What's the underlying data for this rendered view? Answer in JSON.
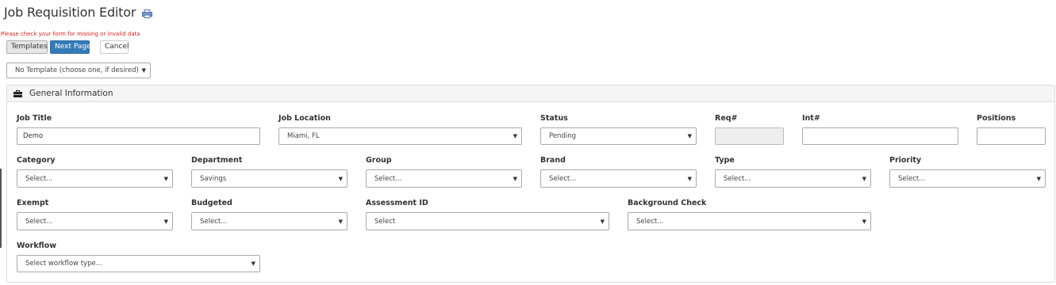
{
  "header": {
    "title": "Job Requisition Editor",
    "icon": "print-icon"
  },
  "error_message": "Please check your form for missing or invalid data",
  "toolbar": {
    "templates_label": "Templates",
    "next_page_label": "Next Page",
    "cancel_label": "Cancel"
  },
  "template_select": {
    "value": "No Template (choose one, if desired)"
  },
  "panel": {
    "title": "General Information",
    "icon": "briefcase-icon"
  },
  "fields": {
    "job_title": {
      "label": "Job Title",
      "value": "Demo"
    },
    "job_location": {
      "label": "Job Location",
      "value": "Miami, FL"
    },
    "status": {
      "label": "Status",
      "value": "Pending"
    },
    "req_number": {
      "label": "Req#",
      "value": ""
    },
    "int_number": {
      "label": "Int#",
      "value": ""
    },
    "positions": {
      "label": "Positions",
      "value": ""
    },
    "category": {
      "label": "Category",
      "value": "Select..."
    },
    "department": {
      "label": "Department",
      "value": "Savings"
    },
    "group": {
      "label": "Group",
      "value": "Select..."
    },
    "brand": {
      "label": "Brand",
      "value": "Select..."
    },
    "type": {
      "label": "Type",
      "value": "Select..."
    },
    "priority": {
      "label": "Priority",
      "value": "Select..."
    },
    "exempt": {
      "label": "Exempt",
      "value": "Select..."
    },
    "budgeted": {
      "label": "Budgeted",
      "value": "Select..."
    },
    "assessment_id": {
      "label": "Assessment ID",
      "value": "Select"
    },
    "background_check": {
      "label": "Background Check",
      "value": "Select..."
    },
    "workflow": {
      "label": "Workflow",
      "value": "Select workflow type..."
    }
  },
  "caret_glyph": "▼",
  "colors": {
    "primary": "#337ab7",
    "error": "#d9231b",
    "panel_bg": "#f5f5f5"
  }
}
